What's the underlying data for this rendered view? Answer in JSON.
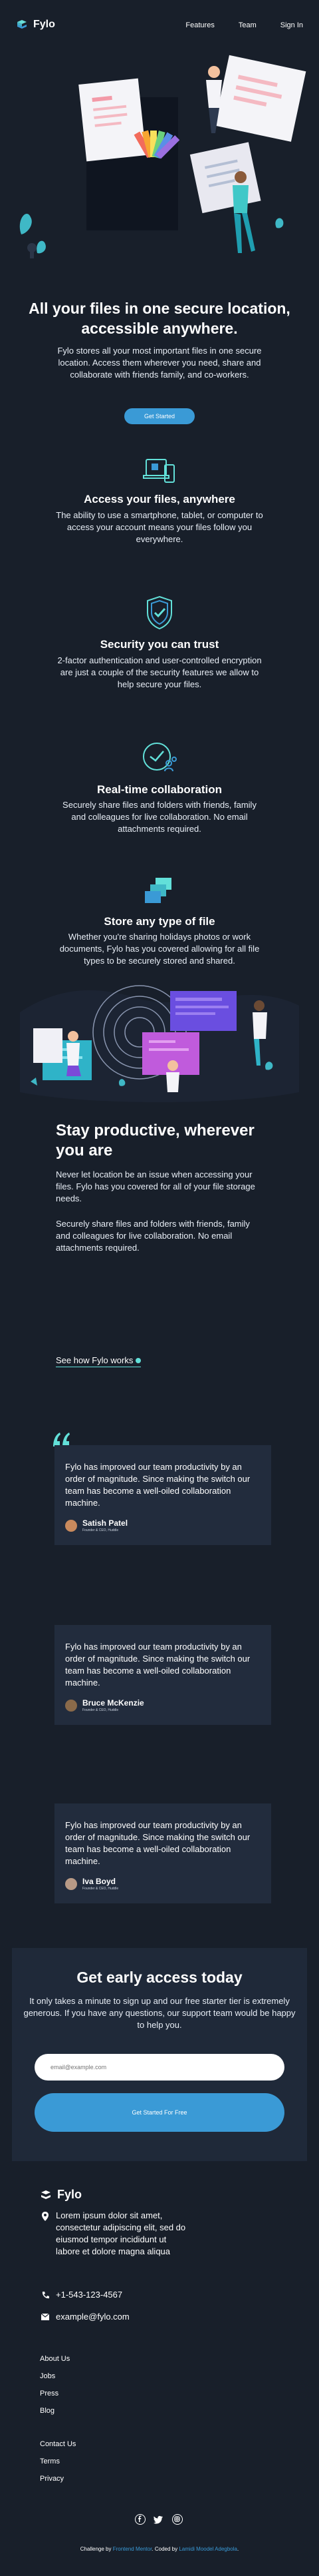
{
  "header": {
    "brand": "Fylo",
    "nav": [
      "Features",
      "Team",
      "Sign In"
    ]
  },
  "hero": {
    "title": "All your files in one secure location, accessible anywhere.",
    "body": "Fylo stores all your most important files in one secure location. Access them wherever you need, share and collaborate with friends family, and co-workers.",
    "cta": "Get Started"
  },
  "features": [
    {
      "icon": "devices-icon",
      "title": "Access your files, anywhere",
      "body": "The ability to use a smartphone, tablet, or computer to access your account means your files follow you everywhere."
    },
    {
      "icon": "shield-check-icon",
      "title": "Security you can trust",
      "body": "2-factor authentication and user-controlled encryption are just a couple of the security features we allow to help secure your files."
    },
    {
      "icon": "collaboration-icon",
      "title": "Real-time collaboration",
      "body": "Securely share files and folders with friends, family and colleagues for live collaboration. No email attachments required."
    },
    {
      "icon": "files-stack-icon",
      "title": "Store any type of file",
      "body": "Whether you're sharing holidays photos or work documents, Fylo has you covered allowing for all file types to be securely stored and shared."
    }
  ],
  "productive": {
    "title": "Stay productive, wherever you are",
    "p1": "Never let location be an issue when accessing your files. Fylo has you covered for all of your file storage needs.",
    "p2": "Securely share files and folders with friends, family and colleagues for live collaboration. No email attachments required.",
    "link": "See how Fylo works"
  },
  "testimonials": [
    {
      "quote": "Fylo has improved our team productivity by an order of magnitude. Since making the switch our team has become a well-oiled collaboration machine.",
      "name": "Satish Patel",
      "role": "Founder & CEO, Huddle",
      "avatar_color": "#c98a5d"
    },
    {
      "quote": "Fylo has improved our team productivity by an order of magnitude. Since making the switch our team has become a well-oiled collaboration machine.",
      "name": "Bruce McKenzie",
      "role": "Founder & CEO, Huddle",
      "avatar_color": "#8a6a4a"
    },
    {
      "quote": "Fylo has improved our team productivity by an order of magnitude. Since making the switch our team has become a well-oiled collaboration machine.",
      "name": "Iva Boyd",
      "role": "Founder & CEO, Huddle",
      "avatar_color": "#b89a86"
    }
  ],
  "early_access": {
    "title": "Get early access today",
    "body": "It only takes a minute to sign up and our free starter tier is extremely generous. If you have any questions, our support team would be happy to help you.",
    "email_placeholder": "email@example.com",
    "submit": "Get Started For Free"
  },
  "footer": {
    "brand": "Fylo",
    "address": "Lorem ipsum dolor sit amet, consectetur adipiscing elit, sed do eiusmod tempor incididunt ut labore et dolore magna aliqua",
    "phone": "+1-543-123-4567",
    "email": "example@fylo.com",
    "links1": [
      "About Us",
      "Jobs",
      "Press",
      "Blog"
    ],
    "links2": [
      "Contact Us",
      "Terms",
      "Privacy"
    ],
    "social": [
      "facebook-icon",
      "twitter-icon",
      "instagram-icon"
    ]
  },
  "credit": {
    "prefix": "Challenge by",
    "challenge_link": "Frontend Mentor",
    "middle": ". Coded by",
    "author_link": "Lamidi Moodel Adegbola",
    "suffix": "."
  },
  "colors": {
    "background": "#181f2a",
    "card": "#222c3d",
    "accent_blue": "#3a9ad6",
    "accent_cyan": "#62e0d9"
  }
}
